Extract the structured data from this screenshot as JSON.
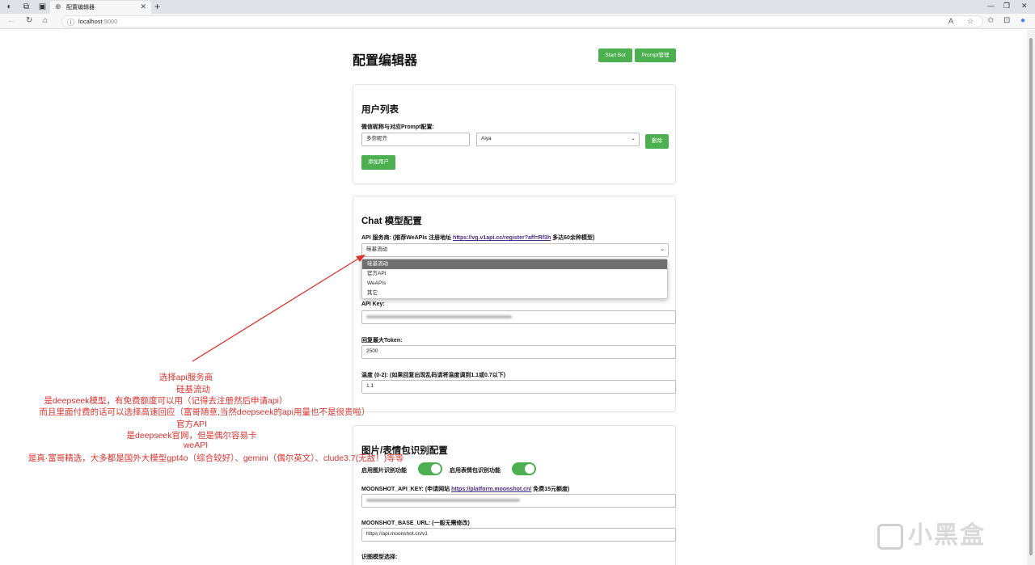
{
  "browser": {
    "tab_title": "配置编辑器",
    "url": "localhost",
    "url_port": ":5000"
  },
  "page": {
    "title": "配置编辑器",
    "start_bot_label": "Start Bot",
    "prompt_manage_label": "Prompt管理"
  },
  "user_list": {
    "heading": "用户列表",
    "field_label": "微信昵称与对应Prompt配置:",
    "nickname_value": "多奈昵齐",
    "prompt_value": "Aiya",
    "delete_label": "删除",
    "add_user_label": "添加用户"
  },
  "chat_config": {
    "heading": "Chat 模型配置",
    "provider_label_prefix": "API 服务商: (推荐WeAPIs 注册地址 ",
    "provider_link": "https://vg.v1api.cc/register?aff=Rf3h",
    "provider_label_suffix": " 多达60余种模型)",
    "provider_value": "硅基流动",
    "provider_options": [
      "硅基流动",
      "官方API",
      "WeAPIs",
      "其它"
    ],
    "api_key_label": "API Key:",
    "max_token_label": "回复最大Token:",
    "max_token_value": "2500",
    "temperature_label": "温度 (0-2): (如果回复出现乱码请将温度调到1.1或0.7以下)",
    "temperature_value": "1.1"
  },
  "image_config": {
    "heading": "图片/表情包识别配置",
    "enable_image_label": "启用图片识别功能",
    "enable_emoji_label": "启用表情包识别功能",
    "moonshot_key_prefix": "MOONSHOT_API_KEY: (申请网站 ",
    "moonshot_key_link": "https://platform.moonshot.cn/",
    "moonshot_key_suffix": " 免费15元额度)",
    "moonshot_url_label": "MOONSHOT_BASE_URL: (一般无需修改)",
    "moonshot_url_value": "https://api.moonshot.cn/v1",
    "model_select_label": "识图模型选择:"
  },
  "annotation": {
    "line1": "选择api服务商",
    "line2": "硅基流动",
    "line3": "是deepseek模型，有免费额度可以用（记得去注册然后申请api）",
    "line4": "而且里面付费的话可以选择高速回应（富哥随意,当然deepseek的api用量也不是很贵啦）",
    "line5": "官方API",
    "line6": "是deepseek官网，但是偶尔容易卡",
    "line7": "weAPI",
    "line8": "是真·富哥精选，大多都是国外大模型gpt4o（综合较好）、gemini（偶尔英文）、clude3.7(无敌！)等等"
  },
  "watermark": {
    "text": "小黑盒"
  },
  "colors": {
    "accent_green": "#4caf50",
    "annotation_red": "#e0322e",
    "link_purple": "#4b2c86"
  }
}
